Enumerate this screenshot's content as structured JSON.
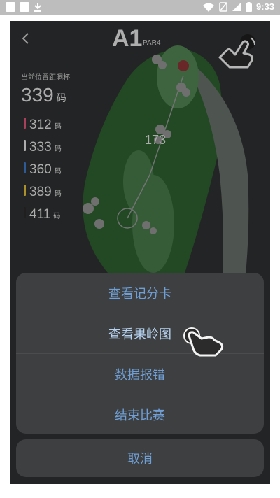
{
  "status_bar": {
    "time": "9:33",
    "icons": [
      "notification-square-icon",
      "notification-square-icon",
      "download-icon",
      "wifi-icon",
      "no-sim-icon",
      "signal-icon",
      "battery-icon"
    ]
  },
  "header": {
    "back_icon": "back-arrow-icon",
    "hole": "A1",
    "par": "PAR4"
  },
  "distance": {
    "label": "当前位置距洞杯",
    "value": "339",
    "unit": "码"
  },
  "tees": [
    {
      "value": "312",
      "unit": "码",
      "color": "#e0567a"
    },
    {
      "value": "333",
      "unit": "码",
      "color": "#e8e8e8"
    },
    {
      "value": "360",
      "unit": "码",
      "color": "#3e78c8"
    },
    {
      "value": "389",
      "unit": "码",
      "color": "#e3c23a"
    },
    {
      "value": "411",
      "unit": "码",
      "color": "#2a2a2a"
    }
  ],
  "map": {
    "marker_label": "173"
  },
  "action_sheet": {
    "items": [
      {
        "label": "查看记分卡"
      },
      {
        "label": "查看果岭图"
      },
      {
        "label": "数据报错"
      },
      {
        "label": "结束比赛"
      }
    ],
    "cancel": "取消"
  },
  "colors": {
    "accent": "#6f9fd6",
    "sheet_bg": "#3e3f40",
    "backdrop": "#2f3132"
  }
}
